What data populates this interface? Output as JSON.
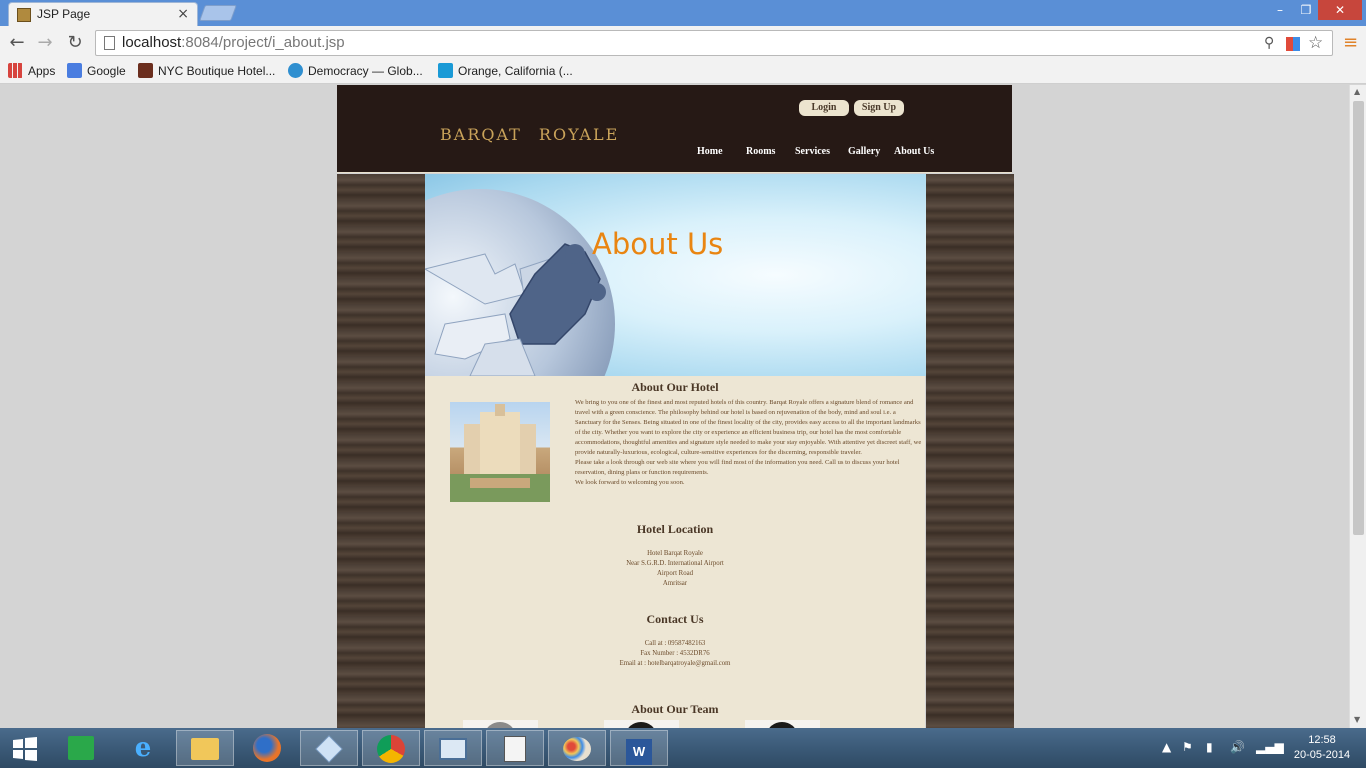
{
  "browser": {
    "tab_title": "JSP Page",
    "tab_close": "×",
    "url_host": "localhost",
    "url_rest": ":8084/project/i_about.jsp",
    "bookmarks": [
      {
        "label": "Apps",
        "color": "#d7443e"
      },
      {
        "label": "Google",
        "color": "#4a7de0"
      },
      {
        "label": "NYC Boutique Hotel...",
        "color": "#6b2e1e"
      },
      {
        "label": "Democracy — Glob...",
        "color": "#2f8fd0"
      },
      {
        "label": "Orange, California (...",
        "color": "#1a9ad6"
      }
    ],
    "icons": {
      "back": "←",
      "forward": "→",
      "reload": "↻",
      "zoom": "🔍",
      "star": "☆",
      "menu": "≡",
      "minimize": "–",
      "maximize": "❐",
      "close": "✕"
    }
  },
  "site": {
    "logo": "BARQAT ROYALE",
    "login_label": "Login",
    "signup_label": "Sign Up",
    "nav": [
      "Home",
      "Rooms",
      "Services",
      "Gallery",
      "About Us"
    ],
    "banner_title": "About Us",
    "about": {
      "title": "About Our Hotel",
      "text": "We bring to you one of the finest and most reputed hotels of this country. Barqat Royale offers a signature blend of romance and travel with a green conscience. The philosophy behind our hotel is based on rejuvenation of the body, mind and soul i.e. a Sanctuary for the Senses. Being situated in one of the finest locality of the city, provides easy access to all the important landmarks of the city. Whether you want to explore the city or experience an efficient business trip, our hotel has the most comfortable accommodations, thoughtful amenities and signature style needed to make your stay enjoyable. With attentive yet discreet staff, we provide naturally-luxurious, ecological, culture-sensitive experiences for the discerning, responsible traveler.",
      "text2": "Please take a look through our web site where you will find most of the information you need. Call us to discuss your hotel reservation, dining plans or function requirements.",
      "text3": "We look forward to welcoming you soon."
    },
    "location": {
      "title": "Hotel Location",
      "lines": [
        "Hotel Barqat Royale",
        "Near S.G.R.D. International Airport",
        "Airport Road",
        "Amritsar"
      ]
    },
    "contact": {
      "title": "Contact Us",
      "lines": [
        "Call at : 09587482163",
        "Fax Number : 4532DR76",
        "Email at : hotelbarqatroyale@gmail.com"
      ]
    },
    "team": {
      "title": "About Our Team"
    },
    "colors": {
      "header_bg": "#261915",
      "logo_gold": "#c9a35a",
      "content_bg": "#ede6d4",
      "banner_title": "#e98511"
    }
  },
  "taskbar": {
    "apps": [
      "windows-store-icon",
      "internet-explorer-icon",
      "file-explorer-icon",
      "firefox-icon",
      "virtualbox-icon",
      "chrome-icon",
      "remote-desktop-icon",
      "notepad-icon",
      "paint-icon",
      "word-icon"
    ],
    "time": "12:58",
    "date": "20-05-2014"
  }
}
